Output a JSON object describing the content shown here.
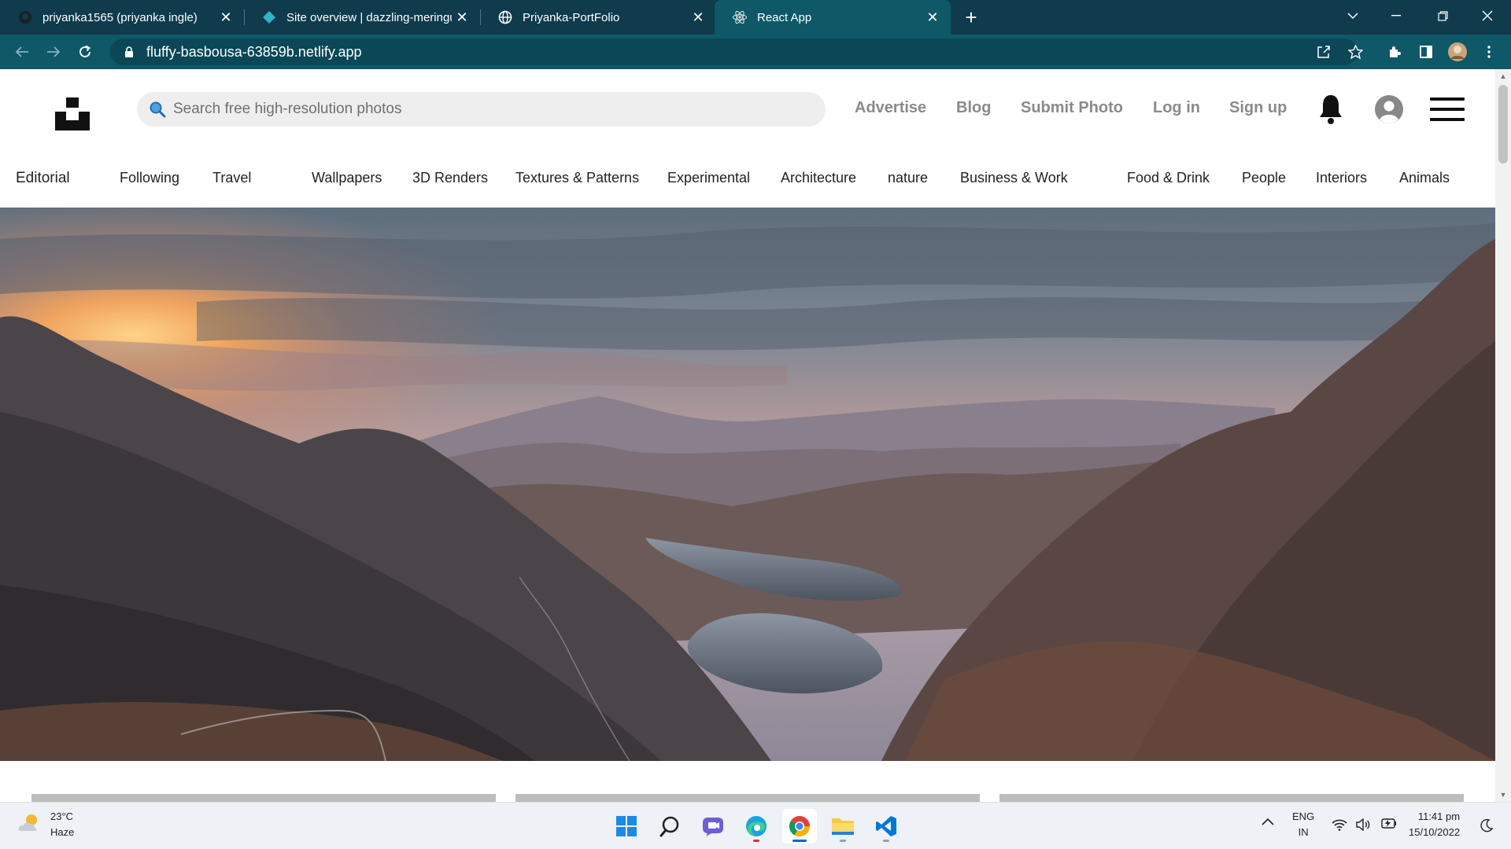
{
  "browser": {
    "tabs": [
      {
        "title": "priyanka1565 (priyanka ingle)",
        "icon": "github-icon",
        "active": false
      },
      {
        "title": "Site overview | dazzling-meringue",
        "icon": "netlify-icon",
        "active": false
      },
      {
        "title": "Priyanka-PortFolio",
        "icon": "globe-icon",
        "active": false
      },
      {
        "title": "React App",
        "icon": "react-icon",
        "active": true
      }
    ],
    "url": "fluffy-basbousa-63859b.netlify.app",
    "accent": "#0e5868"
  },
  "header": {
    "search_placeholder": "Search free high-resolution photos",
    "links": [
      "Advertise",
      "Blog",
      "Submit Photo",
      "Log in",
      "Sign up"
    ]
  },
  "categories": [
    "Editorial",
    "Following",
    "Travel",
    "Wallpapers",
    "3D Renders",
    "Textures & Patterns",
    "Experimental",
    "Architecture",
    "nature",
    "Business & Work",
    "Food & Drink",
    "People",
    "Interiors",
    "Animals"
  ],
  "taskbar": {
    "weather": {
      "temp": "23°C",
      "condition": "Haze"
    },
    "language": {
      "lang": "ENG",
      "region": "IN"
    },
    "time": "11:41 pm",
    "date": "15/10/2022"
  }
}
